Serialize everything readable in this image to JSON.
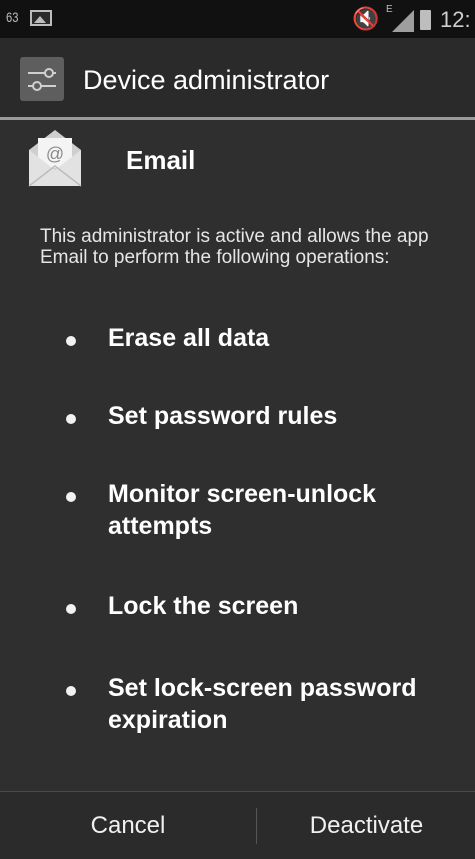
{
  "status_bar": {
    "notification_count": "63",
    "time": "12:",
    "icons": [
      "image-icon",
      "mute-icon",
      "signal-icon",
      "battery-icon"
    ],
    "network_type": "E"
  },
  "action_bar": {
    "title": "Device administrator",
    "icon": "settings-icon"
  },
  "app": {
    "name": "Email",
    "icon": "email-icon"
  },
  "description": "This administrator is active and allows the app Email to perform the following operations:",
  "permissions": [
    "Erase all data",
    "Set password rules",
    "Monitor screen-unlock attempts",
    "Lock the screen",
    "Set lock-screen password expiration"
  ],
  "buttons": {
    "cancel": "Cancel",
    "deactivate": "Deactivate"
  },
  "colors": {
    "background": "#2f2f2f",
    "status_bar": "#111111",
    "action_bar_divider": "#9a9a9a",
    "text": "#ffffff"
  }
}
